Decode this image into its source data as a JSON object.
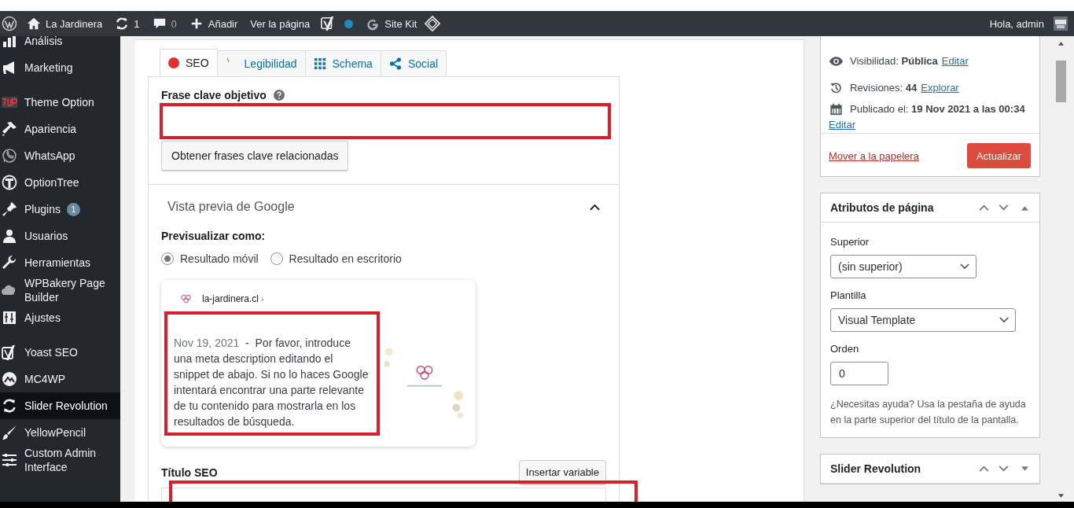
{
  "admin_bar": {
    "site": "La Jardinera",
    "updates": "1",
    "comments": "0",
    "new": "Añadir",
    "view": "Ver la página",
    "site_kit": "Site Kit",
    "greeting": "Hola, admin"
  },
  "sidebar": {
    "items": [
      {
        "label": "Análisis",
        "selected": false
      },
      {
        "label": "Marketing",
        "selected": false
      },
      {
        "label": "Theme Option",
        "selected": false
      },
      {
        "label": "Apariencia",
        "selected": false
      },
      {
        "label": "WhatsApp",
        "selected": false
      },
      {
        "label": "OptionTree",
        "selected": false
      },
      {
        "label": "Plugins",
        "badge": "1",
        "selected": false
      },
      {
        "label": "Usuarios",
        "selected": false
      },
      {
        "label": "Herramientas",
        "selected": false
      },
      {
        "label": "WPBakery Page Builder",
        "selected": false
      },
      {
        "label": "Ajustes",
        "selected": false
      },
      {
        "label": "Yoast SEO",
        "selected": false
      },
      {
        "label": "MC4WP",
        "selected": false
      },
      {
        "label": "Slider Revolution",
        "selected": true
      },
      {
        "label": "YellowPencil",
        "selected": false
      },
      {
        "label": "Custom Admin Interface",
        "selected": false
      }
    ]
  },
  "seo_tabs": [
    {
      "label": "SEO",
      "selected": true,
      "color": "#dc3232"
    },
    {
      "label": "Legibilidad",
      "selected": false
    },
    {
      "label": "Schema",
      "selected": false
    },
    {
      "label": "Social",
      "selected": false
    }
  ],
  "focus_keyphrase": {
    "label": "Frase clave objetivo",
    "highlighted": true,
    "button": "Obtener frases clave relacionadas"
  },
  "google_preview": {
    "title": "Vista previa de Google",
    "expanded": true,
    "preview_as_label": "Previsualizar como:",
    "modes": [
      {
        "label": "Resultado móvil",
        "selected": true
      },
      {
        "label": "Resultado en escritorio",
        "selected": false
      }
    ],
    "snippet": {
      "url": "la-jardinera.cl",
      "breadcrumb": "›",
      "date": "Nov 19, 2021",
      "dash": "-",
      "description": "Por favor, introduce una meta description editando el snippet de abajo. Si no lo haces Google intentará encontrar una parte relevante de tu contenido para mostrarla en los resultados de búsqueda.",
      "highlighted": true
    }
  },
  "seo_title": {
    "label": "Título SEO",
    "insert_button": "Insertar variable",
    "highlighted": true
  },
  "publish_box": {
    "rows": [
      {
        "text": "Visibilidad: **Pública**",
        "link": "Editar"
      },
      {
        "text": "Revisiones: **44**",
        "link": "Explorar"
      },
      {
        "text": "Publicado el: **19 Nov 2021 a las 00:34**",
        "link": "Editar"
      }
    ],
    "trash_link": "Mover a la papelera",
    "update_button": "Actualizar"
  },
  "page_attributes": {
    "title": "Atributos de página",
    "expanded": true,
    "parent_label": "Superior",
    "parent_value": "(sin superior)",
    "template_label": "Plantilla",
    "template_value": "Visual Template",
    "order_label": "Orden",
    "order_value": "0",
    "help": "¿Necesitas ayuda? Usa la pestaña de ayuda en la parte superior del título de la pantalla."
  },
  "slider_box": {
    "title": "Slider Revolution",
    "expanded": false
  }
}
